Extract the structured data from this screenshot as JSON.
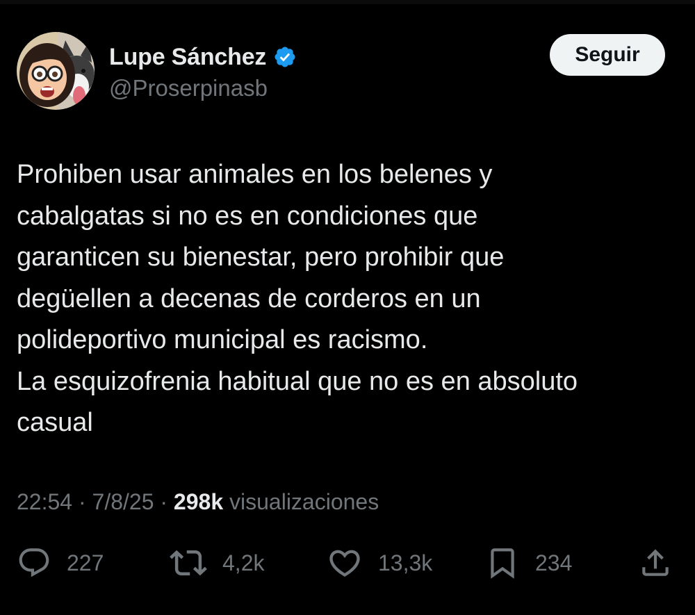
{
  "author": {
    "display_name": "Lupe Sánchez",
    "handle": "@Proserpinasb",
    "verified_icon": "verified-badge-icon",
    "accent_color": "#1d9bf0"
  },
  "follow_button": {
    "label": "Seguir"
  },
  "tweet": {
    "lines": [
      "Prohiben usar animales en los belenes y",
      "cabalgatas si no es en condiciones que",
      "garanticen su bienestar, pero prohibir que",
      "degüellen a decenas de corderos en un",
      "polideportivo municipal es racismo.",
      "La esquizofrenia habitual que no es en absoluto",
      "casual"
    ]
  },
  "meta": {
    "time": "22:54",
    "separator": "·",
    "date": "7/8/25",
    "views_count": "298k",
    "views_label": "visualizaciones"
  },
  "actions": {
    "reply": {
      "icon": "reply-icon",
      "count": "227"
    },
    "retweet": {
      "icon": "retweet-icon",
      "count": "4,2k"
    },
    "like": {
      "icon": "heart-icon",
      "count": "13,3k"
    },
    "bookmark": {
      "icon": "bookmark-icon",
      "count": "234"
    },
    "share": {
      "icon": "share-icon"
    }
  },
  "colors": {
    "background": "#000000",
    "text_primary": "#e7e9ea",
    "text_secondary": "#71767b",
    "button_bg": "#eff3f4",
    "button_text": "#0f1419"
  }
}
